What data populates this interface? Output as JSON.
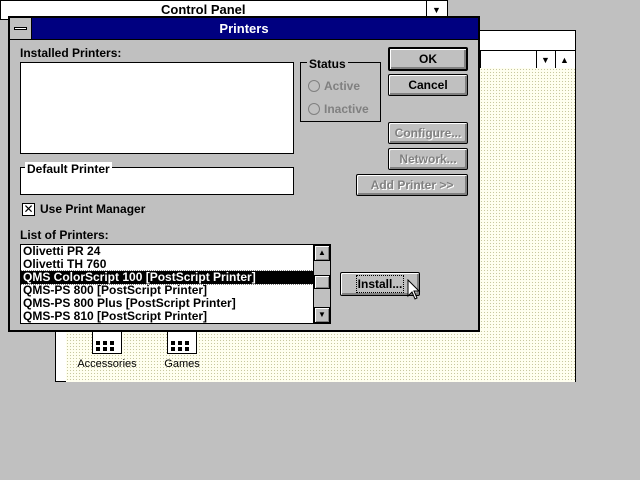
{
  "control_panel": {
    "title": "Control Panel",
    "scroll_icon": "down-arrow-icon"
  },
  "program_manager": {
    "groups": [
      {
        "label": "Accessories",
        "icon": "program-group-icon"
      },
      {
        "label": "Games",
        "icon": "program-group-icon"
      }
    ]
  },
  "dialog": {
    "title": "Printers",
    "installed_printers_label": "Installed Printers:",
    "status": {
      "label": "Status",
      "active_label": "Active",
      "inactive_label": "Inactive"
    },
    "default_printer_label": "Default Printer",
    "use_print_manager": {
      "label": "Use Print Manager",
      "checked": true
    },
    "list_of_printers_label": "List of Printers:",
    "printers": [
      "Olivetti PR 24",
      "Olivetti TH 760",
      "QMS ColorScript 100 [PostScript Printer]",
      "QMS-PS 800 [PostScript Printer]",
      "QMS-PS 800 Plus [PostScript Printer]",
      "QMS-PS 810 [PostScript Printer]"
    ],
    "selected_printer": "QMS ColorScript 100 [PostScript Printer]",
    "buttons": {
      "ok": "OK",
      "cancel": "Cancel",
      "configure": "Configure...",
      "network": "Network...",
      "add_printer": "Add Printer >>",
      "install": "Install..."
    }
  },
  "colors": {
    "caption": "#000080",
    "face": "#c0c0c0",
    "disabled_text": "#808080"
  }
}
